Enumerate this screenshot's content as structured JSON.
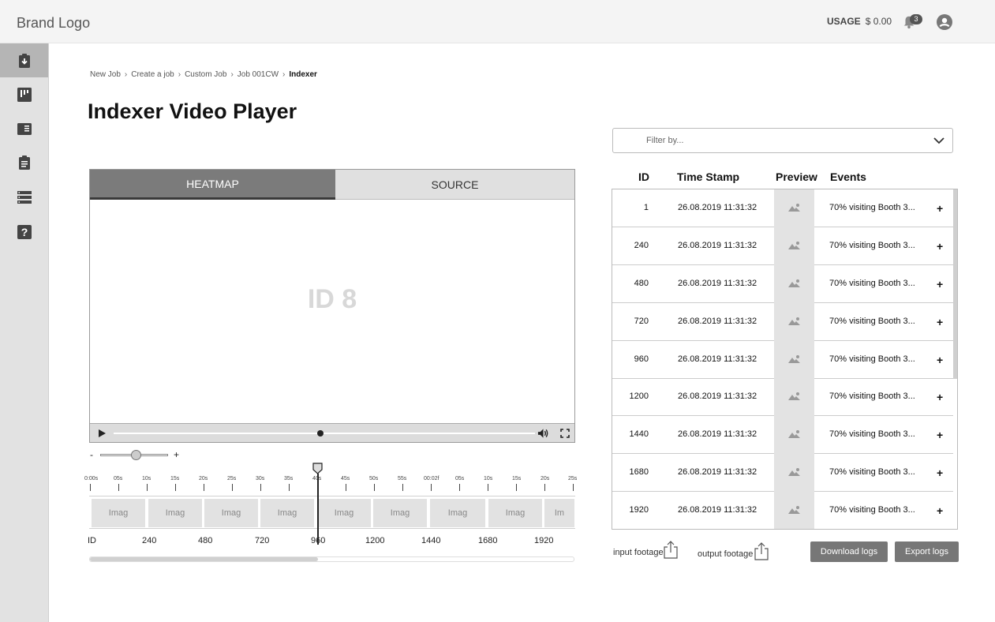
{
  "header": {
    "brand": "Brand Logo",
    "usage_label": "USAGE",
    "usage_value": "$ 0.00",
    "notification_count": "3"
  },
  "breadcrumb": [
    "New Job",
    "Create a job",
    "Custom Job",
    "Job 001CW",
    "Indexer"
  ],
  "page_title": "Indexer Video Player",
  "player": {
    "tab_heatmap": "HEATMAP",
    "tab_source": "SOURCE",
    "video_label": "ID 8"
  },
  "zoom": {
    "minus": "-",
    "plus": "+"
  },
  "timeline": {
    "ticks": [
      "0:00s",
      "05s",
      "10s",
      "15s",
      "20s",
      "25s",
      "30s",
      "35s",
      "40s",
      "45s",
      "50s",
      "55s",
      "00:02f",
      "05s",
      "10s",
      "15s",
      "20s",
      "25s"
    ],
    "thumb_labels": [
      "Imag",
      "Imag",
      "Imag",
      "Imag",
      "Imag",
      "Imag",
      "Imag",
      "Imag",
      "Im"
    ],
    "id_label": "ID",
    "ids": [
      "240",
      "480",
      "720",
      "960",
      "1200",
      "1440",
      "1680",
      "1920"
    ]
  },
  "filter": {
    "placeholder": "Filter by..."
  },
  "table": {
    "columns": [
      "ID",
      "Time Stamp",
      "Preview",
      "Events"
    ],
    "rows": [
      {
        "id": "1",
        "timestamp": "26.08.2019 11:31:32",
        "event": "70% visiting Booth 3...",
        "add": "+"
      },
      {
        "id": "240",
        "timestamp": "26.08.2019 11:31:32",
        "event": "70% visiting Booth 3...",
        "add": "+"
      },
      {
        "id": "480",
        "timestamp": "26.08.2019 11:31:32",
        "event": "70% visiting Booth 3...",
        "add": "+"
      },
      {
        "id": "720",
        "timestamp": "26.08.2019 11:31:32",
        "event": "70% visiting Booth 3...",
        "add": "+"
      },
      {
        "id": "960",
        "timestamp": "26.08.2019 11:31:32",
        "event": "70% visiting Booth 3...",
        "add": "+"
      },
      {
        "id": "1200",
        "timestamp": "26.08.2019 11:31:32",
        "event": "70% visiting Booth 3...",
        "add": "+"
      },
      {
        "id": "1440",
        "timestamp": "26.08.2019 11:31:32",
        "event": "70% visiting Booth 3...",
        "add": "+"
      },
      {
        "id": "1680",
        "timestamp": "26.08.2019 11:31:32",
        "event": "70% visiting Booth 3...",
        "add": "+"
      },
      {
        "id": "1920",
        "timestamp": "26.08.2019 11:31:32",
        "event": "70% visiting Booth 3...",
        "add": "+"
      }
    ]
  },
  "footer": {
    "input_footage": "input footage",
    "output_footage": "output footage",
    "download_logs": "Download logs",
    "export_logs": "Export logs"
  },
  "icons": {
    "sidebar": [
      "clipboard-download-icon",
      "board-icon",
      "book-icon",
      "clipboard-list-icon",
      "list-icon",
      "help-icon"
    ]
  }
}
